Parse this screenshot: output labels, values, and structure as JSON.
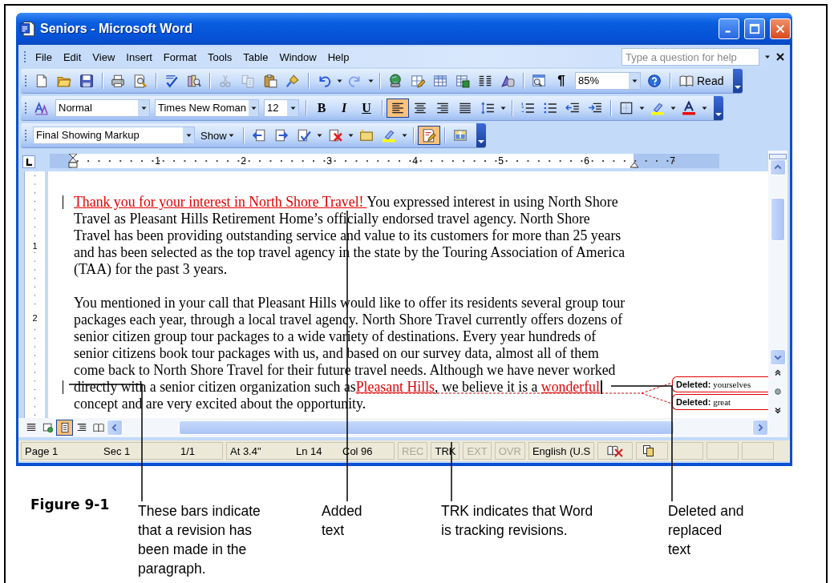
{
  "window": {
    "title": "Seniors - Microsoft Word"
  },
  "menu_bar": {
    "items": [
      {
        "label": "File"
      },
      {
        "label": "Edit"
      },
      {
        "label": "View"
      },
      {
        "label": "Insert"
      },
      {
        "label": "Format"
      },
      {
        "label": "Tools"
      },
      {
        "label": "Table"
      },
      {
        "label": "Window"
      },
      {
        "label": "Help"
      }
    ],
    "help_box": {
      "placeholder": "Type a question for help"
    }
  },
  "standard_toolbar": {
    "edit_buttons": [
      {
        "disabled": true
      },
      {
        "disabled": true
      },
      {
        "disabled": false
      }
    ],
    "history_buttons": [
      {
        "disabled": false
      },
      {
        "disabled": true
      }
    ],
    "pilcrow": "¶",
    "zoom": "85%",
    "read_button": {
      "label": "Read"
    }
  },
  "formatting_toolbar": {
    "style": "Normal",
    "font": "Times New Roman",
    "size": "12",
    "bold": "B",
    "italic": "I",
    "underline": "U",
    "alignment_buttons": [
      {
        "selected": true
      },
      {
        "selected": false
      },
      {
        "selected": false
      },
      {
        "selected": false
      }
    ]
  },
  "reviewing_toolbar": {
    "display": "Final Showing Markup",
    "show_menu": {
      "label": "Show"
    },
    "track_changes": {
      "selected": true
    }
  },
  "ruler": {
    "marks": [
      "1",
      "2",
      "3",
      "4",
      "5",
      "6",
      "7"
    ]
  },
  "vertical_ruler": {
    "marks": [
      "1",
      "2"
    ]
  },
  "document": {
    "paragraphs": [
      {
        "lines": [
          {
            "change_bar": true,
            "cursor": false,
            "runs": [
              {
                "kind": "inserted",
                "text": "Thank you for your interest in North Shore Travel! "
              },
              {
                "kind": "plain",
                "text": "You expressed interest in using North Shore"
              }
            ]
          },
          {
            "change_bar": false,
            "cursor": false,
            "runs": [
              {
                "kind": "plain",
                "text": "Travel as Pleasant Hills Retirement Home’s officially endorsed travel agency. North Shore"
              }
            ]
          },
          {
            "change_bar": false,
            "cursor": false,
            "runs": [
              {
                "kind": "plain",
                "text": "Travel has been providing outstanding service and value to its customers for more than 25 years"
              }
            ]
          },
          {
            "change_bar": false,
            "cursor": false,
            "runs": [
              {
                "kind": "plain",
                "text": "and has been selected as the top travel agency in the state by the Touring Association of America"
              }
            ]
          },
          {
            "change_bar": false,
            "cursor": false,
            "runs": [
              {
                "kind": "plain",
                "text": "(TAA) for the past 3 years."
              }
            ]
          }
        ]
      },
      {
        "lines": [
          {
            "change_bar": false,
            "cursor": false,
            "runs": [
              {
                "kind": "plain",
                "text": "You mentioned in your call that Pleasant Hills would like to offer its residents several group tour"
              }
            ]
          },
          {
            "change_bar": false,
            "cursor": false,
            "runs": [
              {
                "kind": "plain",
                "text": "packages each year, through a local travel agency. North Shore Travel currently offers dozens of"
              }
            ]
          },
          {
            "change_bar": false,
            "cursor": false,
            "runs": [
              {
                "kind": "plain",
                "text": "senior citizen group tour packages to a wide variety of destinations. Every year hundreds of"
              }
            ]
          },
          {
            "change_bar": false,
            "cursor": false,
            "runs": [
              {
                "kind": "plain",
                "text": "senior citizens book tour packages with us, and based on our survey data, almost all of them"
              }
            ]
          },
          {
            "change_bar": false,
            "cursor": false,
            "runs": [
              {
                "kind": "plain",
                "text": "come back to North Shore Travel for their future travel needs. Although we have never worked"
              }
            ]
          },
          {
            "change_bar": true,
            "cursor": true,
            "runs": [
              {
                "kind": "plain",
                "text": "directly with a senior citizen organization such as"
              },
              {
                "kind": "inserted",
                "text": "Pleasant Hills"
              },
              {
                "kind": "plain",
                "text": ", we believe it is a "
              },
              {
                "kind": "inserted",
                "text": "wonderful"
              }
            ]
          },
          {
            "change_bar": false,
            "cursor": false,
            "runs": [
              {
                "kind": "plain",
                "text": "concept and are very excited about the opportunity."
              }
            ]
          }
        ]
      }
    ]
  },
  "balloons": [
    {
      "text": "**Deleted:** yourselves"
    },
    {
      "text": "**Deleted:** great"
    }
  ],
  "view_buttons": [
    {
      "selected": false
    },
    {
      "selected": false
    },
    {
      "selected": true
    },
    {
      "selected": false
    },
    {
      "selected": false
    }
  ],
  "status_bar": {
    "position": [
      "Page 1",
      "Sec 1",
      "1/1"
    ],
    "cursor": [
      "At 3.4\"",
      "Ln 14",
      "Col 96"
    ],
    "modes": [
      {
        "text": "REC",
        "disabled": true
      },
      {
        "text": "TRK",
        "disabled": false
      },
      {
        "text": "EXT",
        "disabled": true
      },
      {
        "text": "OVR",
        "disabled": true
      }
    ],
    "language": "English (U.S"
  },
  "figure": {
    "label": "Figure 9-1",
    "callouts": [
      "These bars indicate\nthat a revision has\nbeen made in the\nparagraph.",
      "Added\ntext",
      "TRK indicates that Word\nis tracking revisions.",
      "Deleted and\nreplaced\ntext"
    ]
  }
}
